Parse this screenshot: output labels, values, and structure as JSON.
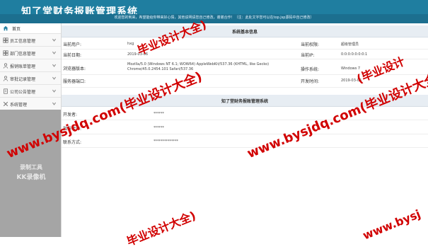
{
  "header": {
    "title": "知了堂财务报账管理系统",
    "notice": "欢迎您的到来，希望能给你带来好心情，其他说明请您自己修改，谢谢合作！（注：此处文字您可以在top.jsp源码中自己修改）"
  },
  "sidebar": {
    "home_label": "首页",
    "items": [
      {
        "label": "员工信息管理",
        "icon": "grid-icon"
      },
      {
        "label": "部门信息管理",
        "icon": "grid-icon"
      },
      {
        "label": "报销账单管理",
        "icon": "person-icon"
      },
      {
        "label": "审批记录管理",
        "icon": "person-icon"
      },
      {
        "label": "公司公告管理",
        "icon": "document-icon"
      },
      {
        "label": "系统管理",
        "icon": "tools-icon"
      }
    ],
    "logo_line1": "录制工具",
    "logo_line2": "KK录像机"
  },
  "system_panel": {
    "title": "系统基本信息",
    "current_user_label": "当前用户:",
    "current_user_value": "hxg",
    "role_label": "当前权限:",
    "role_value": "超级管理员",
    "date_label": "当前日期:",
    "date_value": "2019-03-06",
    "ip_label": "当前IP:",
    "ip_value": "0:0:0:0:0:0:0:1",
    "browser_label": "浏览器版本:",
    "browser_value": "Mozilla/5.0 (Windows NT 6.1; WOW64) AppleWebKit/537.36 (KHTML, like Gecko) Chrome/45.0.2454.101 Safari/537.36",
    "os_label": "操作系统:",
    "os_value": "Windows 7",
    "port_label": "服务器端口:",
    "port_value": "",
    "dev_time_label": "开发时间:",
    "dev_time_value": "2019-03-06"
  },
  "about_panel": {
    "title": "知了堂财务报账管理系统",
    "developer_label": "开发者:",
    "developer_value": "******",
    "teacher_label": "指导老师:",
    "teacher_value": "******",
    "contact_label": "联系方式:",
    "contact_value": "**************"
  },
  "watermark": {
    "text": "www.bysjdq.com(毕业设计大全)",
    "partial_1": "毕业设计大全)",
    "partial_2": "(毕业设计",
    "partial_3": "毕业设计大全)",
    "partial_4": "www.bysj",
    "color": "#d10000"
  }
}
